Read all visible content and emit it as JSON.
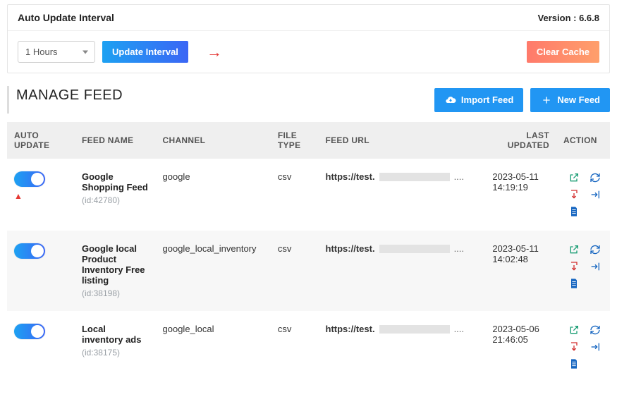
{
  "panel": {
    "title": "Auto Update Interval",
    "version": "Version : 6.6.8",
    "interval_selected": "1 Hours",
    "update_btn": "Update Interval",
    "clear_cache_btn": "Clear Cache"
  },
  "section": {
    "title": "MANAGE FEED",
    "import_btn": "Import Feed",
    "new_feed_btn": "New Feed"
  },
  "columns": {
    "auto_update": "AUTO UPDATE",
    "feed_name": "FEED NAME",
    "channel": "CHANNEL",
    "file_type": "FILE TYPE",
    "feed_url": "FEED URL",
    "last_updated": "LAST UPDATED",
    "action": "ACTION"
  },
  "rows": [
    {
      "auto_update": true,
      "name": "Google Shopping Feed",
      "id": "(id:42780)",
      "channel": "google",
      "file_type": "csv",
      "url_prefix": "https://test.",
      "url_suffix": "....",
      "updated_date": "2023-05-11",
      "updated_time": "14:19:19"
    },
    {
      "auto_update": true,
      "name": "Google local Product Inventory Free listing",
      "id": "(id:38198)",
      "channel": "google_local_inventory",
      "file_type": "csv",
      "url_prefix": "https://test.",
      "url_suffix": "....",
      "updated_date": "2023-05-11",
      "updated_time": "14:02:48"
    },
    {
      "auto_update": true,
      "name": "Local inventory ads",
      "id": "(id:38175)",
      "channel": "google_local",
      "file_type": "csv",
      "url_prefix": "https://test.",
      "url_suffix": "....",
      "updated_date": "2023-05-06",
      "updated_time": "21:46:05"
    }
  ],
  "icons": {
    "open": "open-external-icon",
    "refresh": "refresh-icon",
    "download": "download-icon",
    "export": "export-icon",
    "doc": "document-icon",
    "cloud": "cloud-download-icon",
    "plus": "plus-icon"
  }
}
